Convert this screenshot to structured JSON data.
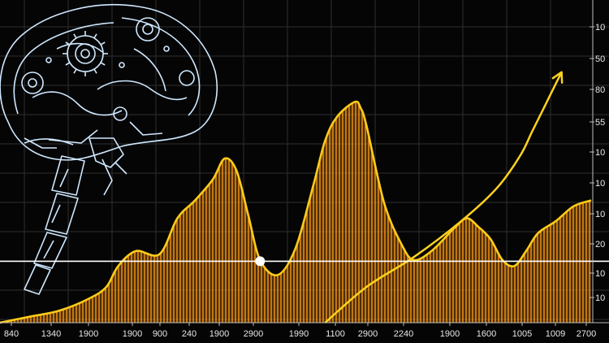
{
  "chart_data": {
    "type": "area",
    "title": "",
    "xlabel": "",
    "ylabel": "",
    "grid": true,
    "legend": "none",
    "x_tick_labels": [
      "840",
      "1340",
      "1900",
      "1900",
      "900",
      "240",
      "1900",
      "2900",
      "1990",
      "1100",
      "2900",
      "2240",
      "1900",
      "1600",
      "1005",
      "1009",
      "2700"
    ],
    "y_tick_labels": [
      "10",
      "50",
      "80",
      "55",
      "10",
      "10",
      "10",
      "20",
      "10",
      "10"
    ],
    "ylim": [
      0,
      100
    ],
    "series": [
      {
        "x": [
          0,
          5,
          10,
          15,
          18,
          20,
          23,
          27,
          30,
          33,
          36,
          38,
          40,
          42,
          44,
          47,
          50,
          53,
          55,
          57,
          60,
          61,
          62,
          65,
          68,
          70,
          73,
          77,
          79,
          81,
          83,
          85,
          87,
          89,
          91,
          94,
          97,
          100
        ],
        "values": [
          0,
          2,
          4,
          8,
          12,
          19,
          24,
          23,
          35,
          41,
          48,
          55,
          51,
          36,
          21,
          16,
          25,
          46,
          61,
          69,
          74,
          72,
          66,
          40,
          26,
          21,
          24,
          32,
          35,
          32,
          28,
          21,
          19,
          24,
          30,
          34,
          39,
          41
        ]
      }
    ],
    "trend": {
      "x": [
        55,
        62,
        70,
        78,
        84,
        88,
        90,
        92,
        93.5,
        95
      ],
      "values": [
        0,
        12,
        22,
        34,
        45,
        56,
        64,
        72,
        78,
        84
      ]
    },
    "reference_line": 20.6,
    "marker": {
      "x": 44,
      "value": 20.6
    },
    "colors": {
      "curve": "#ffcc1a",
      "fill": "#ff9a14",
      "trend": "#ffd21f",
      "grid": "#2e2e2e",
      "reference": "#ffffff",
      "marker": "#ffffff",
      "decoration": "#cfe8ff"
    },
    "decoration": "robot-brain-illustration"
  }
}
